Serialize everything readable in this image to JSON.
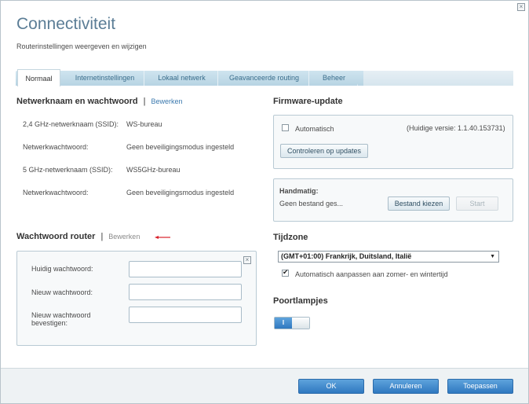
{
  "window": {
    "close_symbol": "×",
    "close_icon": "close-icon"
  },
  "header": {
    "title": "Connectiviteit",
    "subtitle": "Routerinstellingen weergeven en wijzigen"
  },
  "tabs": [
    {
      "label": "Normaal",
      "active": true
    },
    {
      "label": "Internetinstellingen",
      "active": false
    },
    {
      "label": "Lokaal netwerk",
      "active": false
    },
    {
      "label": "Geavanceerde routing",
      "active": false
    },
    {
      "label": "Beheer",
      "active": false
    }
  ],
  "network": {
    "heading": "Netwerknaam en wachtwoord",
    "separator": "|",
    "edit_label": "Bewerken",
    "rows": [
      {
        "label": "2,4 GHz-netwerknaam (SSID):",
        "value": "WS-bureau"
      },
      {
        "label": "Netwerkwachtwoord:",
        "value": "Geen beveiligingsmodus ingesteld"
      },
      {
        "label": "5 GHz-netwerknaam (SSID):",
        "value": "WS5GHz-bureau"
      },
      {
        "label": "Netwerkwachtwoord:",
        "value": "Geen beveiligingsmodus ingesteld"
      }
    ]
  },
  "router_password": {
    "heading": "Wachtwoord router",
    "separator": "|",
    "edit_label": "Bewerken",
    "close_symbol": "×",
    "fields": [
      {
        "label": "Huidig wachtwoord:",
        "value": ""
      },
      {
        "label": "Nieuw wachtwoord:",
        "value": ""
      },
      {
        "label": "Nieuw wachtwoord bevestigen:",
        "value": ""
      }
    ]
  },
  "firmware": {
    "heading": "Firmware-update",
    "auto_label": "Automatisch",
    "auto_checked": false,
    "version_text": "(Huidige versie: 1.1.40.153731)",
    "check_button": "Controleren op updates",
    "manual_label": "Handmatig:",
    "file_status": "Geen bestand ges...",
    "choose_button": "Bestand kiezen",
    "start_button": "Start"
  },
  "timezone": {
    "heading": "Tijdzone",
    "selected": "(GMT+01:00) Frankrijk, Duitsland, Italië",
    "dropdown_arrow": "▼",
    "dst_label": "Automatisch aanpassen aan zomer- en wintertijd",
    "dst_checked": true
  },
  "port_lights": {
    "heading": "Poortlampjes",
    "toggle_on_label": "I",
    "toggle_on": true
  },
  "footer": {
    "ok_label": "OK",
    "cancel_label": "Annuleren",
    "apply_label": "Toepassen"
  },
  "colors": {
    "accent": "#2f78c0",
    "title": "#5b7d96",
    "annotation_arrow": "#d9202a"
  }
}
